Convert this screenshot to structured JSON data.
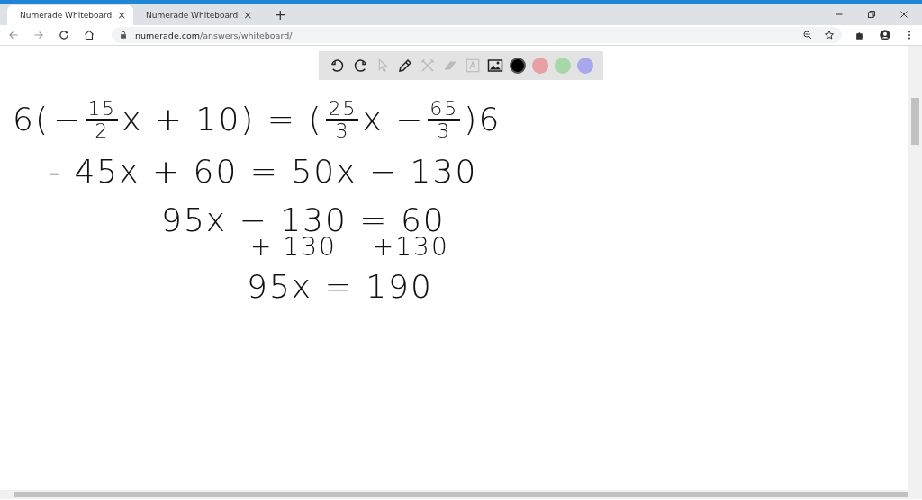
{
  "tabs": [
    {
      "label": "Numerade Whiteboard",
      "selected": true,
      "close": "×"
    },
    {
      "label": "Numerade Whiteboard",
      "selected": false,
      "close": "×"
    }
  ],
  "new_tab": "+",
  "address_bar": {
    "domain": "numerade.com",
    "path": "/answers/whiteboard/"
  },
  "toolbar": {
    "tools": [
      {
        "kind": "undo",
        "disabled": false
      },
      {
        "kind": "redo",
        "disabled": false
      },
      {
        "kind": "select",
        "disabled": true
      },
      {
        "kind": "pen",
        "disabled": false
      },
      {
        "kind": "tools",
        "disabled": true
      },
      {
        "kind": "eraser",
        "disabled": true
      },
      {
        "kind": "text",
        "disabled": true
      },
      {
        "kind": "image",
        "disabled": false
      }
    ],
    "colors": [
      {
        "color": "#000000",
        "selected": true
      },
      {
        "color": "#e8a0a4",
        "selected": false
      },
      {
        "color": "#a6d8a8",
        "selected": false
      },
      {
        "color": "#aaa8ec",
        "selected": false
      }
    ]
  },
  "whiteboard": {
    "lines": [
      [
        {
          "t": "6("
        },
        {
          "t": "−"
        },
        {
          "num": "15",
          "den": "2"
        },
        {
          "t": "x + 10) = ("
        },
        {
          "num": "25",
          "den": "3"
        },
        {
          "t": "x −"
        },
        {
          "num": "65",
          "den": "3"
        },
        {
          "t": ")6"
        }
      ],
      [
        {
          "t": "- 45x + 60 = 50x − 130"
        }
      ],
      [
        {
          "t": "95x − 130 = 60"
        }
      ],
      [
        {
          "t": "+ 130"
        },
        {
          "t": "+130"
        }
      ],
      [
        {
          "t": "95x = 190"
        }
      ]
    ]
  }
}
